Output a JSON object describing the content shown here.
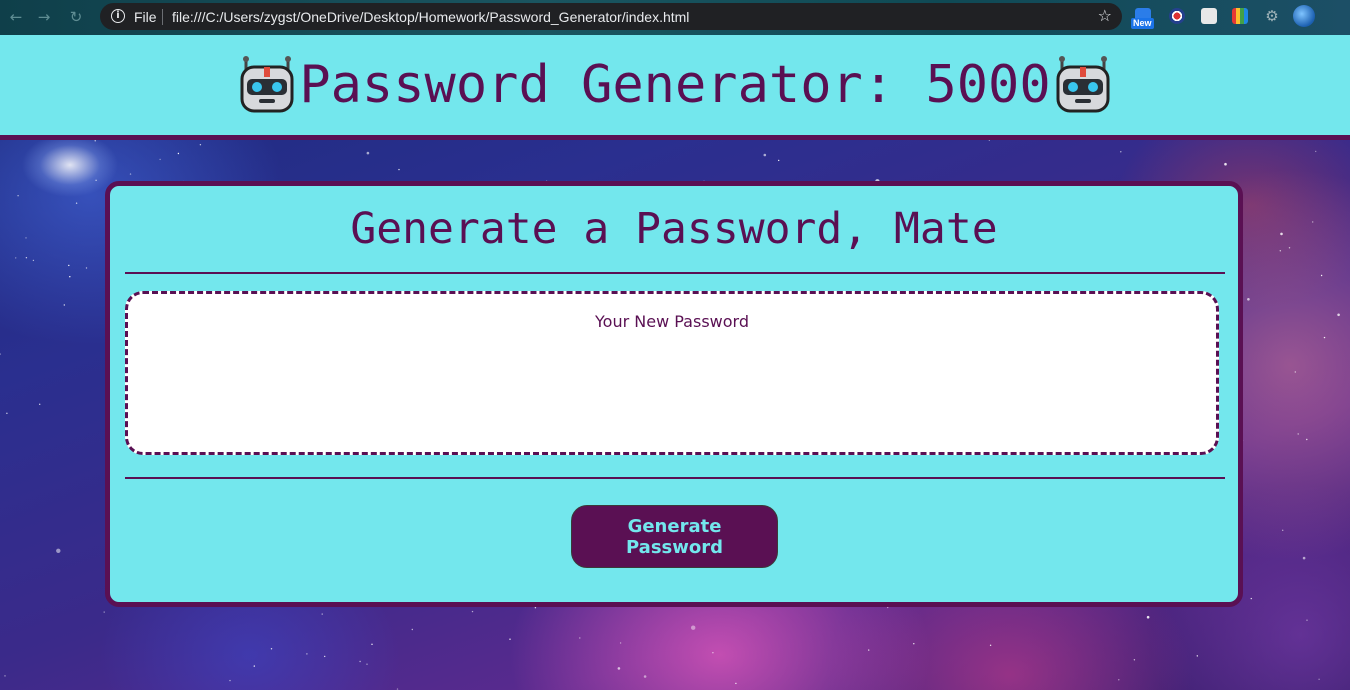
{
  "browser": {
    "scheme_label": "File",
    "url": "file:///C:/Users/zygst/OneDrive/Desktop/Homework/Password_Generator/index.html",
    "extension_badge": "New"
  },
  "header": {
    "title": "Password Generator: 5000",
    "icon": "robot-icon"
  },
  "card": {
    "title": "Generate a Password, Mate",
    "password_placeholder": "Your New Password",
    "password_value": "",
    "button_label": "Generate Password"
  },
  "colors": {
    "accent": "#73e7ed",
    "brand": "#5a1053",
    "field_background": "#ffffff"
  }
}
